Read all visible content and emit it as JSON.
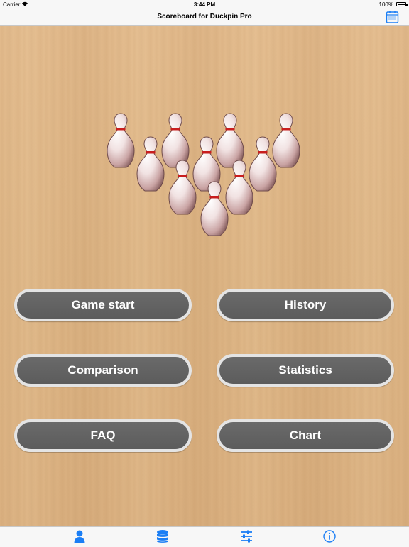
{
  "status_bar": {
    "carrier": "Carrier",
    "time": "3:44 PM",
    "battery": "100%"
  },
  "nav": {
    "title": "Scoreboard for Duckpin Pro",
    "right_icon": "calendar-icon"
  },
  "menu": {
    "game_start": "Game start",
    "history": "History",
    "comparison": "Comparison",
    "statistics": "Statistics",
    "faq": "FAQ",
    "chart": "Chart"
  },
  "tabs": [
    {
      "icon": "person-icon"
    },
    {
      "icon": "database-icon"
    },
    {
      "icon": "sliders-icon"
    },
    {
      "icon": "info-icon"
    }
  ],
  "colors": {
    "accent": "#1a7ef5",
    "button_fill": "#606060",
    "button_border": "#e4e4e4",
    "pin_stripe": "#c81e1e"
  }
}
